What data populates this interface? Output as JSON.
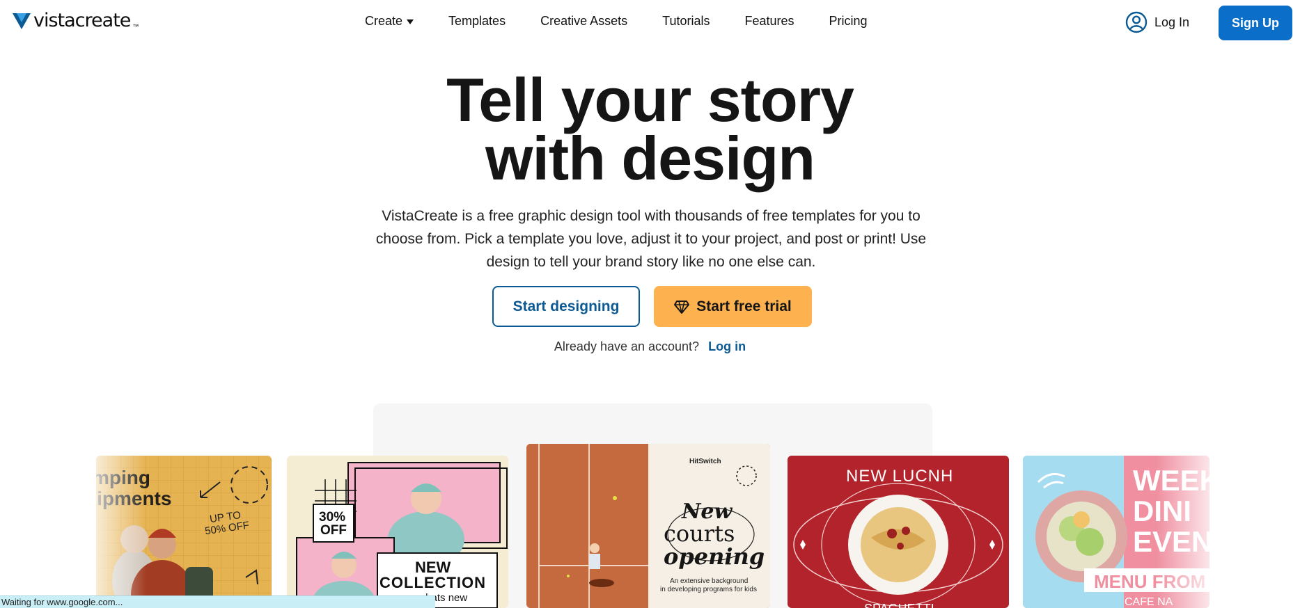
{
  "brand": {
    "name": "vistacreate",
    "tm": "™",
    "logo_color": "#0b5a94"
  },
  "nav": {
    "items": [
      {
        "label": "Create",
        "has_dropdown": true
      },
      {
        "label": "Templates"
      },
      {
        "label": "Creative Assets"
      },
      {
        "label": "Tutorials"
      },
      {
        "label": "Features"
      },
      {
        "label": "Pricing"
      }
    ],
    "login_label": "Log In",
    "signup_label": "Sign Up",
    "signup_color": "#0b6ec8"
  },
  "hero": {
    "title_line1": "Tell your story",
    "title_line2": "with design",
    "description": "VistaCreate is a free graphic design tool with thousands of free templates for you to choose from. Pick a template you love, adjust it to your project, and post or print! Use design to tell your brand story like no one else can.",
    "primary_button": "Start designing",
    "trial_button": "Start free trial",
    "trial_color": "#fdb24f",
    "account_prompt": "Already have an account?",
    "account_link": "Log in"
  },
  "showcase": {
    "card1": {
      "heading_1": "mping",
      "heading_2": "uipments",
      "badge_1": "UP TO",
      "badge_2": "50% OFF"
    },
    "card2": {
      "badge_1": "30%",
      "badge_2": "OFF",
      "heading_1": "NEW",
      "heading_2": "COLLECTION",
      "sub": "see whats new"
    },
    "card3": {
      "brand": "HitSwitch",
      "line1": "New",
      "line2": "courts",
      "line3": "opening",
      "sub1": "An extensive background",
      "sub2": "in developing programs for kids"
    },
    "card4": {
      "heading": "NEW LUCNH",
      "footer": "SPAGHETTI"
    },
    "card5": {
      "line1": "WEEK",
      "line2": "DINI",
      "line3": "EVEN",
      "banner": "MENU FROM CI",
      "footer": "CAFE NA"
    }
  },
  "status_bar": {
    "text": "Waiting for www.google.com..."
  }
}
